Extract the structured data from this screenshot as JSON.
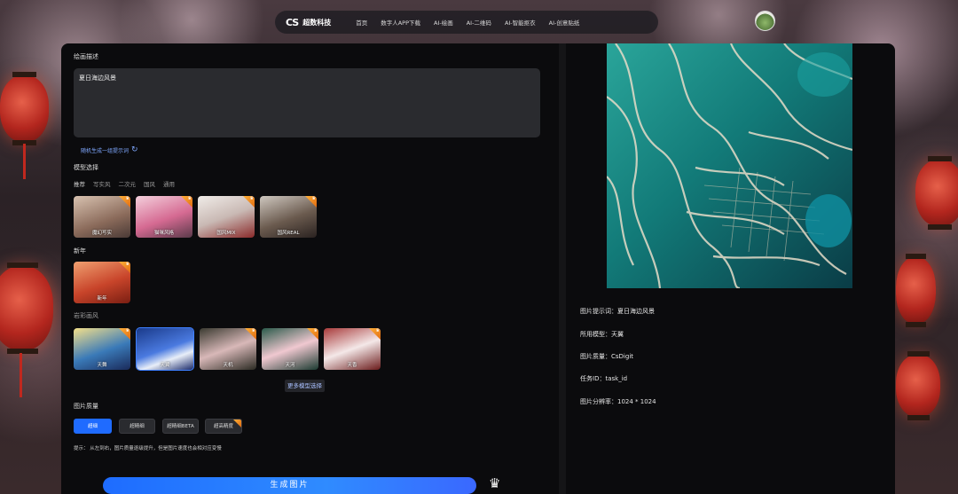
{
  "nav": {
    "brand_logo": "CS",
    "brand_name": "超数科技",
    "items": [
      "首页",
      "数字人APP下载",
      "AI-绘画",
      "AI-二维码",
      "AI-智能抠衣",
      "AI-创意贴纸"
    ]
  },
  "left": {
    "prompt_label": "绘画描述",
    "prompt_value": "夏日海边风景",
    "random_link": "随机生成一组提示词",
    "model_label": "模型选择",
    "tabs": [
      "推荐",
      "写实风",
      "二次元",
      "国风",
      "通用"
    ],
    "models_row1": [
      "魔幻写实",
      "猫咪风格",
      "国风MIX",
      "国风REAL"
    ],
    "section_newyear": "新年",
    "newyear_model": "新年",
    "section_color": "岩彩画风",
    "models_row3": [
      "天舞",
      "天翼",
      "天机",
      "天河",
      "天香"
    ],
    "more_models": "更多模型选择",
    "quality_label": "图片质量",
    "quality_options": [
      "超细",
      "超精细",
      "超精细BETA",
      "超高精度"
    ],
    "hint": "提示： 从左到右，图片质量逐级提升，但是图片速度也会相对应变慢",
    "generate": "生成图片"
  },
  "right": {
    "info": [
      "图片提示词：夏日海边风景",
      "所用模型：天翼",
      "图片质量：CsDigit",
      "任务ID：task_id",
      "图片分辨率：1024 * 1024"
    ]
  },
  "colors": {
    "accent": "#1f6bff",
    "vip": "#f08c1e",
    "panel": "#0b0b0d"
  },
  "icons": [
    "refresh-icon",
    "crown-icon",
    "vip-crown-icon"
  ]
}
